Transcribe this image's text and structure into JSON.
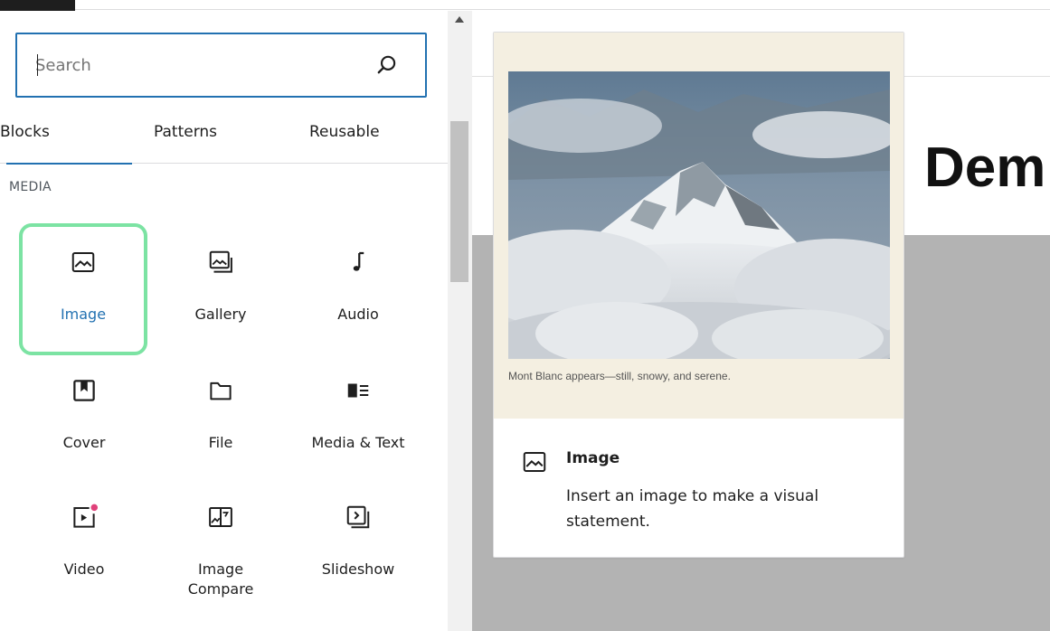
{
  "search": {
    "placeholder": "Search"
  },
  "tabs": [
    {
      "label": "Blocks",
      "active": true
    },
    {
      "label": "Patterns",
      "active": false
    },
    {
      "label": "Reusable",
      "active": false
    }
  ],
  "section_title": "MEDIA",
  "blocks": [
    {
      "label": "Image",
      "icon": "image-icon",
      "selected": true
    },
    {
      "label": "Gallery",
      "icon": "gallery-icon",
      "selected": false
    },
    {
      "label": "Audio",
      "icon": "audio-icon",
      "selected": false
    },
    {
      "label": "Cover",
      "icon": "cover-icon",
      "selected": false
    },
    {
      "label": "File",
      "icon": "file-icon",
      "selected": false
    },
    {
      "label": "Media & Text",
      "icon": "media-text-icon",
      "selected": false
    },
    {
      "label": "Video",
      "icon": "video-icon",
      "selected": false
    },
    {
      "label": "Image Compare",
      "icon": "image-compare-icon",
      "selected": false
    },
    {
      "label": "Slideshow",
      "icon": "slideshow-icon",
      "selected": false
    }
  ],
  "preview": {
    "caption": "Mont Blanc appears—still, snowy, and serene.",
    "name": "Image",
    "description": "Insert an image to make a visual statement.",
    "icon": "image-icon"
  },
  "canvas": {
    "title_fragment": "Dem"
  },
  "colors": {
    "accent": "#2271b1",
    "selection_highlight": "#7ce3a3",
    "preview_background": "#f4efe1",
    "canvas_gray": "#b3b3b3",
    "video_dot": "#e0417a"
  }
}
